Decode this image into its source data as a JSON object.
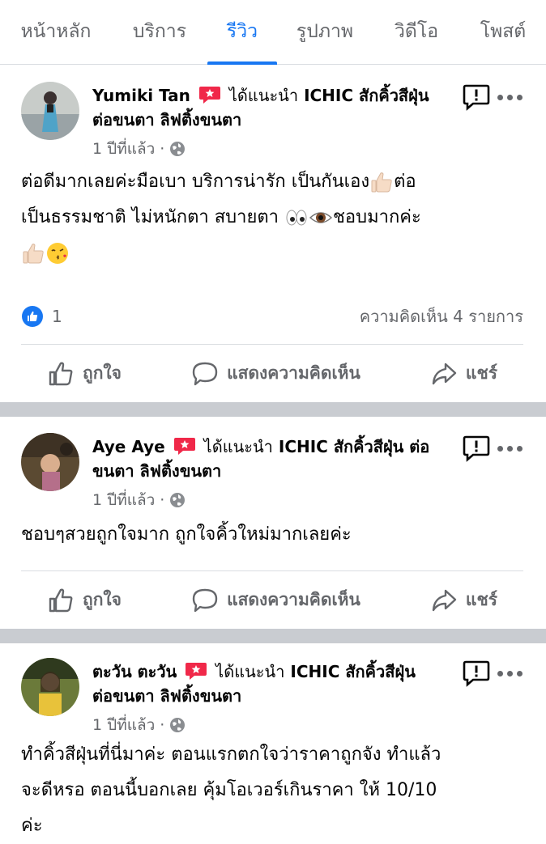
{
  "tabs": [
    {
      "label": "หน้าหลัก",
      "active": false
    },
    {
      "label": "บริการ",
      "active": false
    },
    {
      "label": "รีวิว",
      "active": true
    },
    {
      "label": "รูปภาพ",
      "active": false
    },
    {
      "label": "วิดีโอ",
      "active": false
    },
    {
      "label": "โพสต์",
      "active": false
    }
  ],
  "colors": {
    "accent": "#1877f2",
    "muted": "#65676b",
    "divider": "#c9ccd1",
    "badge": "#f02849"
  },
  "reviews": [
    {
      "author": "Yumiki Tan",
      "recommend_text": "ได้แนะนำ",
      "page": "ICHIC สักคิ้วสีฝุ่น ต่อขนตา ลิฟติ้งขนตา",
      "time": "1 ปีที่แล้ว",
      "text_line1": "ต่อดีมากเลยค่ะมือเบา บริการน่ารัก เป็นกันเอง",
      "text_line1b": "ต่อ",
      "text_line2": "เป็นธรรมชาติ ไม่หนักตา สบายตา",
      "text_line2b": "ชอบมากค่ะ",
      "likes": "1",
      "comments": "ความคิดเห็น 4 รายการ"
    },
    {
      "author": "Aye Aye",
      "recommend_text": "ได้แนะนำ",
      "page": "ICHIC สักคิ้วสีฝุ่น ต่อขนตา ลิฟติ้งขนตา",
      "time": "1 ปีที่แล้ว",
      "text": "ชอบๆสวยถูกใจมาก ถูกใจคิ้วใหม่มากเลยค่ะ"
    },
    {
      "author": "ตะวัน ตะวัน",
      "recommend_text": "ได้แนะนำ",
      "page": "ICHIC สักคิ้วสีฝุ่น ต่อขนตา ลิฟติ้งขนตา",
      "time": "1 ปีที่แล้ว",
      "text_line1": "ทำคิ้วสีฝุ่นที่นี่มาค่ะ ตอนแรกตกใจว่าราคาถูกจัง ทำแล้ว",
      "text_line2": "จะดีหรอ ตอนนี้บอกเลย คุ้มโอเวอร์เกินราคา ให้ 10/10",
      "text_line3": "ค่ะ"
    }
  ],
  "actions": {
    "like": "ถูกใจ",
    "comment": "แสดงความคิดเห็น",
    "share": "แชร์"
  },
  "icons": [
    "recommend-badge-icon",
    "globe-icon",
    "report-icon",
    "more-icon",
    "like-icon",
    "comment-icon",
    "share-icon",
    "thumbs-up-emoji-icon",
    "eyes-emoji-icon",
    "eye-emoji-icon",
    "kiss-emoji-icon",
    "like-reaction-icon"
  ]
}
